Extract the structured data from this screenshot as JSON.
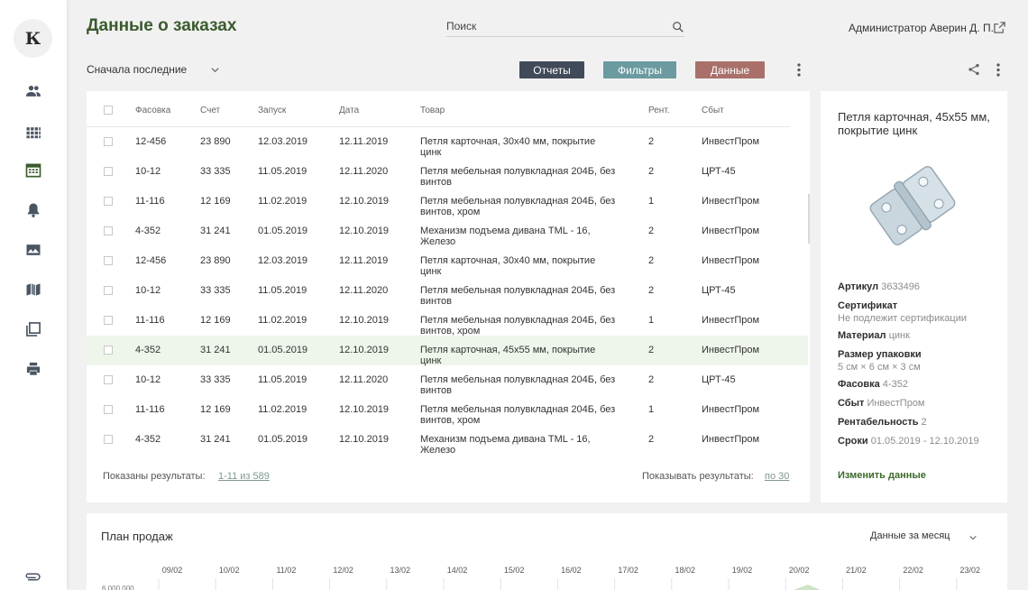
{
  "app": {
    "logo_letter": "К"
  },
  "nav": [
    {
      "icon": "people-icon"
    },
    {
      "icon": "grid-icon"
    },
    {
      "icon": "table-view-icon",
      "active": true
    },
    {
      "icon": "bell-icon"
    },
    {
      "icon": "image-icon"
    },
    {
      "icon": "map-icon"
    },
    {
      "icon": "library-icon"
    },
    {
      "icon": "print-icon"
    }
  ],
  "bottom_icon": "attachment-icon",
  "header": {
    "title": "Данные о заказах",
    "search_placeholder": "Поиск",
    "user": "Администратор Аверин Д. П."
  },
  "toolbar": {
    "sort_label": "Сначала последние",
    "reports": "Отчеты",
    "filters": "Фильтры",
    "data": "Данные"
  },
  "colors": {
    "accent": "#3b5a2e",
    "btn_reports": "#414a59",
    "btn_filters": "#6b9aa0",
    "btn_data": "#a9706a",
    "selected_row": "#eef5ea"
  },
  "table": {
    "headers": [
      "Фасовка",
      "Счет",
      "Запуск",
      "Дата",
      "Товар",
      "Рент.",
      "Сбыт"
    ],
    "rows": [
      {
        "pack": "12-456",
        "account": "23 890",
        "launch": "12.03.2019",
        "date": "12.11.2019",
        "product": "Петля карточная, 30х40 мм, покрытие цинк",
        "rent": "2",
        "sales": "ИнвестПром"
      },
      {
        "pack": "10-12",
        "account": "33 335",
        "launch": "11.05.2019",
        "date": "12.11.2020",
        "product": "Петля мебельная полувкладная 204Б, без винтов",
        "rent": "2",
        "sales": "ЦРТ-45"
      },
      {
        "pack": "11-116",
        "account": "12 169",
        "launch": "11.02.2019",
        "date": "12.10.2019",
        "product": "Петля мебельная полувкладная 204Б, без винтов, хром",
        "rent": "1",
        "sales": "ИнвестПром"
      },
      {
        "pack": "4-352",
        "account": "31 241",
        "launch": "01.05.2019",
        "date": "12.10.2019",
        "product": "Механизм подъема дивана TML - 16, Железо",
        "rent": "2",
        "sales": "ИнвестПром"
      },
      {
        "pack": "12-456",
        "account": "23 890",
        "launch": "12.03.2019",
        "date": "12.11.2019",
        "product": "Петля карточная, 30х40 мм, покрытие цинк",
        "rent": "2",
        "sales": "ИнвестПром"
      },
      {
        "pack": "10-12",
        "account": "33 335",
        "launch": "11.05.2019",
        "date": "12.11.2020",
        "product": "Петля мебельная полувкладная 204Б, без винтов",
        "rent": "2",
        "sales": "ЦРТ-45"
      },
      {
        "pack": "11-116",
        "account": "12 169",
        "launch": "11.02.2019",
        "date": "12.10.2019",
        "product": "Петля мебельная полувкладная 204Б, без винтов, хром",
        "rent": "1",
        "sales": "ИнвестПром"
      },
      {
        "pack": "4-352",
        "account": "31 241",
        "launch": "01.05.2019",
        "date": "12.10.2019",
        "product": "Петля карточная, 45х55 мм, покрытие цинк",
        "rent": "2",
        "sales": "ИнвестПром",
        "selected": true
      },
      {
        "pack": "10-12",
        "account": "33 335",
        "launch": "11.05.2019",
        "date": "12.11.2020",
        "product": "Петля мебельная полувкладная 204Б, без винтов",
        "rent": "2",
        "sales": "ЦРТ-45"
      },
      {
        "pack": "11-116",
        "account": "12 169",
        "launch": "11.02.2019",
        "date": "12.10.2019",
        "product": "Петля мебельная полувкладная 204Б, без винтов, хром",
        "rent": "1",
        "sales": "ИнвестПром"
      },
      {
        "pack": "4-352",
        "account": "31 241",
        "launch": "01.05.2019",
        "date": "12.10.2019",
        "product": "Механизм подъема дивана TML - 16, Железо",
        "rent": "2",
        "sales": "ИнвестПром"
      }
    ],
    "footer": {
      "shown_label": "Показаны результаты:",
      "shown_value": "1-11 из 589",
      "per_page_label": "Показывать результаты:",
      "per_page_value": "по 30"
    }
  },
  "detail": {
    "title": "Петля карточная, 45х55 мм, покрытие цинк",
    "image_icon": "hinge-image",
    "fields": [
      {
        "label": "Артикул",
        "value": "3633496",
        "inline": true
      },
      {
        "label": "Сертификат",
        "value": "Не подлежит сертификации",
        "inline": false
      },
      {
        "label": "Материал",
        "value": "цинк",
        "inline": true
      },
      {
        "label": "Размер упаковки",
        "value": "5 см × 6 см × 3 см",
        "inline": false
      },
      {
        "label": "Фасовка",
        "value": "4-352",
        "inline": true
      },
      {
        "label": "Сбыт",
        "value": "ИнвестПром",
        "inline": true
      },
      {
        "label": "Рентабельность",
        "value": "2",
        "inline": true
      },
      {
        "label": "Сроки",
        "value": "01.05.2019 - 12.10.2019",
        "inline": true
      }
    ],
    "edit_label": "Изменить данные"
  },
  "chart": {
    "title": "План продаж",
    "period": "Данные за месяц"
  },
  "chart_data": {
    "type": "area",
    "x": [
      "09/02",
      "10/02",
      "11/02",
      "12/02",
      "13/02",
      "14/02",
      "15/02",
      "16/02",
      "17/02",
      "18/02",
      "19/02",
      "20/02",
      "21/02",
      "22/02",
      "23/02"
    ],
    "ytick_visible": "6 000 000",
    "title": "",
    "xlabel": "",
    "ylabel": "",
    "grid": true
  }
}
